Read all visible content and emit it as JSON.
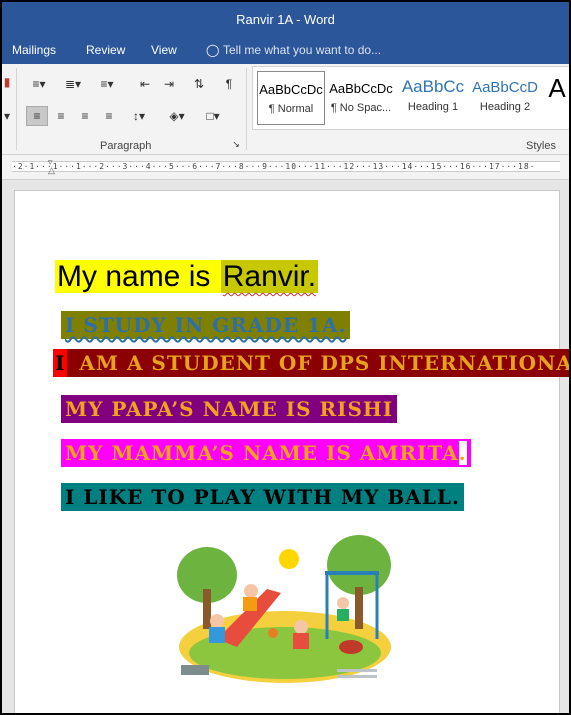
{
  "window": {
    "title": "Ranvir  1A - Word"
  },
  "tabs": [
    {
      "label": "Mailings"
    },
    {
      "label": "Review"
    },
    {
      "label": "View"
    }
  ],
  "tell_me": {
    "placeholder": "Tell me what you want to do..."
  },
  "ribbon": {
    "paragraph_label": "Paragraph",
    "styles_label": "Styles",
    "styles": [
      {
        "preview": "AaBbCcDc",
        "name": "¶ Normal",
        "color": "#000000"
      },
      {
        "preview": "AaBbCcDc",
        "name": "¶ No Spac...",
        "color": "#000000"
      },
      {
        "preview": "AaBbCc",
        "name": "Heading 1",
        "color": "#2e74b5"
      },
      {
        "preview": "AaBbCcD",
        "name": "Heading 2",
        "color": "#2e74b5"
      },
      {
        "preview": "A",
        "name": "",
        "color": "#000000"
      }
    ]
  },
  "ruler": {
    "text": "·2·1···1···1···2···3···4···5···6···7···8···9···10···11···12···13···14···15···16···17···18·"
  },
  "document": {
    "line1_a": "My name is ",
    "line1_b": "Ranvir.",
    "line2": "I study  in grade 1A.",
    "line3_a": "I",
    "line3_b": " am a student of DPS International",
    "line3_c": ".",
    "line4": "My papa’s name is Rishi",
    "line5": "My mamma’s name is Amrita",
    "line5_c": ".",
    "line6": "I like to play with my ball."
  },
  "colors": {
    "titlebar": "#2b579a",
    "highlight_yellow": "#ffff00",
    "highlight_olive": "#808000",
    "highlight_darkred": "#8b0000",
    "highlight_purple": "#800080",
    "highlight_magenta": "#ff00ff",
    "highlight_teal": "#008080",
    "text_orange": "#f2a21c"
  }
}
